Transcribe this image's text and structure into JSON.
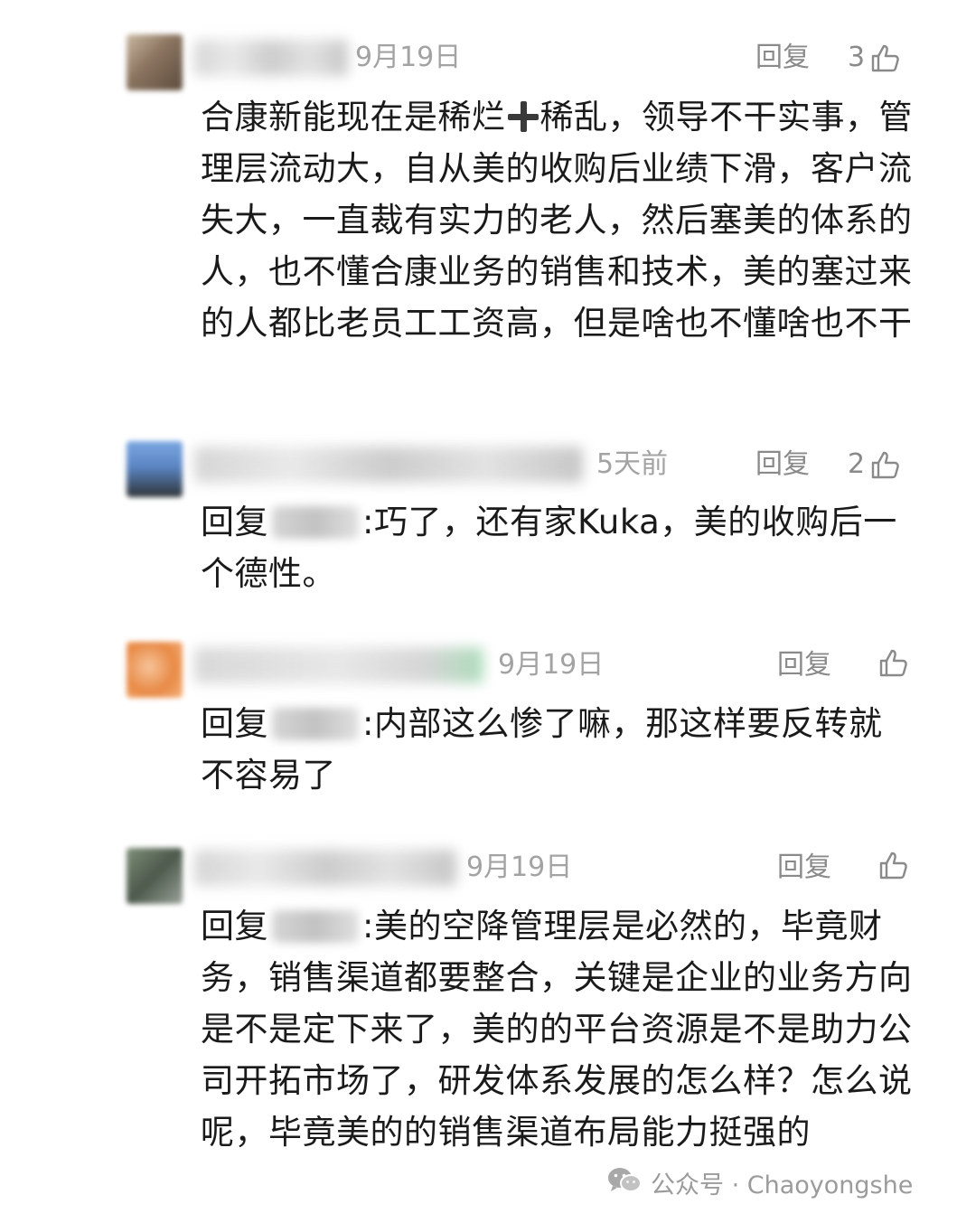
{
  "comments": [
    {
      "date": "9月19日",
      "reply_label": "回复",
      "like_count": "3",
      "text": "合康新能现在是稀烂",
      "text_rest": "稀乱，领导不干实事，管理层流动大，自从美的收购后业绩下滑，客户流失大，一直裁有实力的老人，然后塞美的体系的人，也不懂合康业务的销售和技术，美的塞过来的人都比老员工工资高，但是啥也不懂啥也不干",
      "avatar_color": "#8a7460"
    },
    {
      "date": "5天前",
      "reply_label": "回复",
      "like_count": "2",
      "reply_prefix": "回复",
      "text": ":巧了，还有家Kuka，美的收购后一个德性。",
      "avatar_color": "#5b86c4"
    },
    {
      "date": "9月19日",
      "reply_label": "回复",
      "like_count": "",
      "reply_prefix": "回复",
      "text": ":内部这么惨了嘛，那这样要反转就不容易了",
      "avatar_color": "#e88a46"
    },
    {
      "date": "9月19日",
      "reply_label": "回复",
      "like_count": "",
      "reply_prefix": "回复",
      "text": ":美的空降管理层是必然的，毕竟财务，销售渠道都要整合，关键是企业的业务方向是不是定下来了，美的的平台资源是不是助力公司开拓市场了，研发体系发展的怎么样？怎么说呢，毕竟美的的销售渠道布局能力挺强的",
      "avatar_color": "#4d5a4c"
    }
  ],
  "watermark": {
    "text": "公众号 · Chaoyongshe",
    "icon": "wechat-icon"
  }
}
